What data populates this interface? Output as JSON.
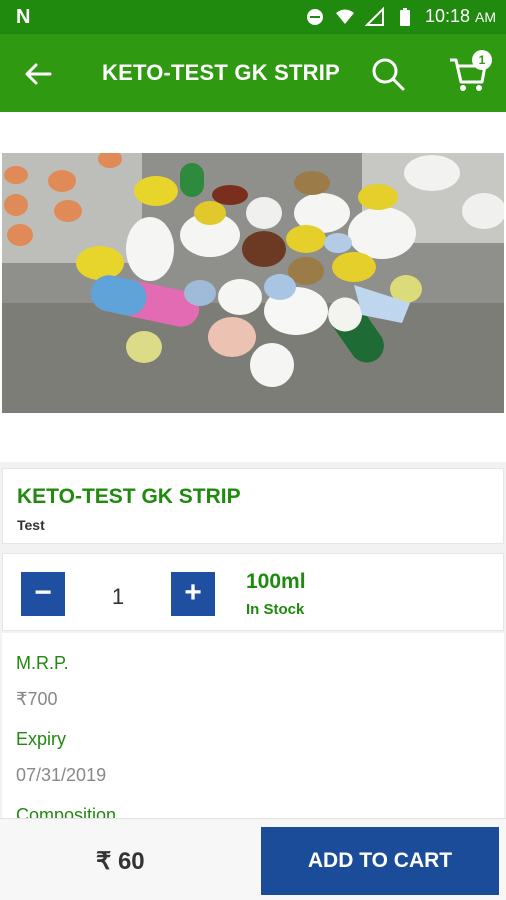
{
  "status_bar": {
    "left_label": "N",
    "time": "10:18",
    "time_suffix": "AM"
  },
  "app_bar": {
    "title": "KETO-TEST GK STRIP",
    "cart_count": "1"
  },
  "product": {
    "name": "KETO-TEST GK STRIP",
    "subtitle": "Test",
    "quantity": "1",
    "minus_label": "−",
    "plus_label": "+",
    "size": "100ml",
    "stock_status": "In Stock",
    "details": {
      "mrp_label": "M.R.P.",
      "mrp_value": "₹700",
      "expiry_label": "Expiry",
      "expiry_value": "07/31/2019",
      "composition_label": "Composition"
    }
  },
  "bottom_bar": {
    "price": "₹ 60",
    "add_to_cart_label": "ADD TO CART"
  },
  "colors": {
    "primary_green": "#2e9911",
    "status_green": "#1f8a0e",
    "action_blue": "#1a4c9a"
  }
}
